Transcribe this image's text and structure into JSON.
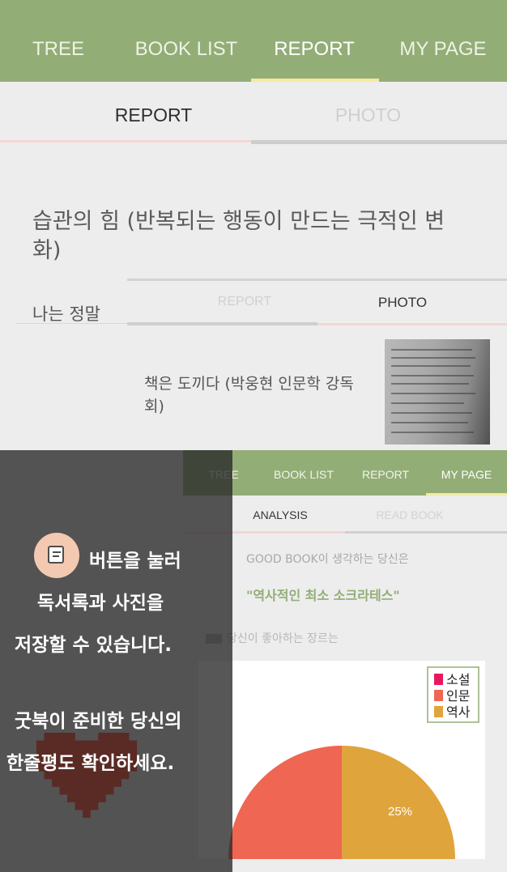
{
  "top_nav": {
    "tabs": [
      "TREE",
      "BOOK LIST",
      "REPORT",
      "MY PAGE"
    ],
    "active": "REPORT"
  },
  "sub_tabs": {
    "left": "REPORT",
    "right": "PHOTO"
  },
  "report": {
    "book_title": "습관의 힘 (반복되는 행동이 만드는 극적인 변화)",
    "note": "나는 정말"
  },
  "photo_screen": {
    "tabs": [
      "REPORT",
      "PHOTO"
    ],
    "item_title": "책은 도끼다 (박웅현 인문학 강독회)"
  },
  "analysis_screen": {
    "nav_tabs": [
      "TREE",
      "BOOK LIST",
      "REPORT",
      "MY PAGE"
    ],
    "sub_tabs": [
      "ANALYSIS",
      "READ BOOK"
    ],
    "question": "GOOD BOOK이 생각하는 당신은",
    "answer": "\"역사적인 최소 소크라테스\"",
    "genre_prompt": "당신이 좋아하는 장르는"
  },
  "overlay_hint": {
    "line1": "버튼을 눌러",
    "line2": "독서록과 사진을",
    "line3": "저장할 수 있습니다.",
    "line4": "굿북이 준비한 당신의",
    "line5": "한줄평도 확인하세요."
  },
  "colors": {
    "nav_green": "#93ad76",
    "accent_yellow": "#f3e9a2",
    "accent_pink": "#f3d6d2"
  },
  "chart_data": {
    "type": "pie",
    "categories": [
      "소설",
      "인문",
      "역사"
    ],
    "colors": [
      "#e8185e",
      "#ef6652",
      "#e0a43c"
    ],
    "values": [
      null,
      null,
      25
    ],
    "data_labels": [
      "",
      "",
      "25%"
    ]
  }
}
